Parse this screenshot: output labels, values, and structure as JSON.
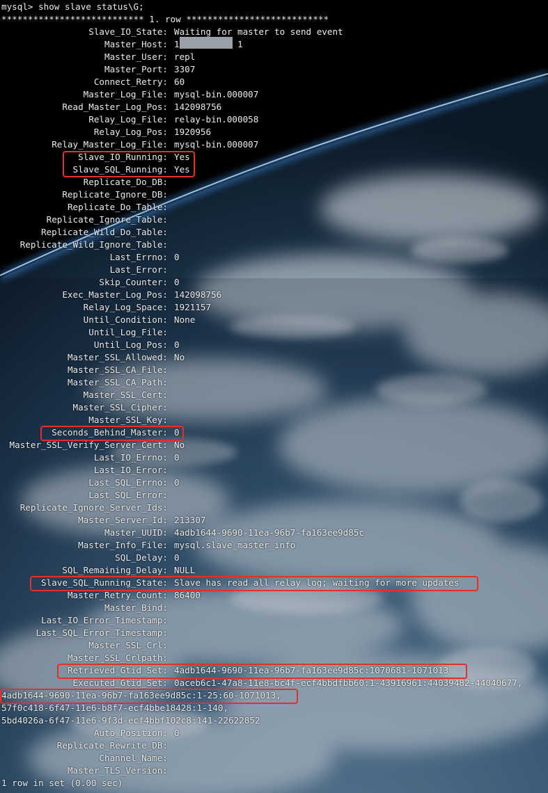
{
  "terminal": {
    "prompt": "mysql> show slave status\\G;",
    "row_header": "*************************** 1. row ***************************",
    "fields": [
      {
        "key": "Slave_IO_State",
        "value": "Waiting for master to send event"
      },
      {
        "key": "Master_Host",
        "value": "1           1"
      },
      {
        "key": "Master_User",
        "value": "repl"
      },
      {
        "key": "Master_Port",
        "value": "3307"
      },
      {
        "key": "Connect_Retry",
        "value": "60"
      },
      {
        "key": "Master_Log_File",
        "value": "mysql-bin.000007"
      },
      {
        "key": "Read_Master_Log_Pos",
        "value": "142098756"
      },
      {
        "key": "Relay_Log_File",
        "value": "relay-bin.000058"
      },
      {
        "key": "Relay_Log_Pos",
        "value": "1920956"
      },
      {
        "key": "Relay_Master_Log_File",
        "value": "mysql-bin.000007"
      },
      {
        "key": "Slave_IO_Running",
        "value": "Yes"
      },
      {
        "key": "Slave_SQL_Running",
        "value": "Yes"
      },
      {
        "key": "Replicate_Do_DB",
        "value": ""
      },
      {
        "key": "Replicate_Ignore_DB",
        "value": ""
      },
      {
        "key": "Replicate_Do_Table",
        "value": ""
      },
      {
        "key": "Replicate_Ignore_Table",
        "value": ""
      },
      {
        "key": "Replicate_Wild_Do_Table",
        "value": ""
      },
      {
        "key": "Replicate_Wild_Ignore_Table",
        "value": ""
      },
      {
        "key": "Last_Errno",
        "value": "0"
      },
      {
        "key": "Last_Error",
        "value": ""
      },
      {
        "key": "Skip_Counter",
        "value": "0"
      },
      {
        "key": "Exec_Master_Log_Pos",
        "value": "142098756"
      },
      {
        "key": "Relay_Log_Space",
        "value": "1921157"
      },
      {
        "key": "Until_Condition",
        "value": "None"
      },
      {
        "key": "Until_Log_File",
        "value": ""
      },
      {
        "key": "Until_Log_Pos",
        "value": "0"
      },
      {
        "key": "Master_SSL_Allowed",
        "value": "No"
      },
      {
        "key": "Master_SSL_CA_File",
        "value": ""
      },
      {
        "key": "Master_SSL_CA_Path",
        "value": ""
      },
      {
        "key": "Master_SSL_Cert",
        "value": ""
      },
      {
        "key": "Master_SSL_Cipher",
        "value": ""
      },
      {
        "key": "Master_SSL_Key",
        "value": ""
      },
      {
        "key": "Seconds_Behind_Master",
        "value": "0"
      },
      {
        "key": "Master_SSL_Verify_Server_Cert",
        "value": "No"
      },
      {
        "key": "Last_IO_Errno",
        "value": "0"
      },
      {
        "key": "Last_IO_Error",
        "value": ""
      },
      {
        "key": "Last_SQL_Errno",
        "value": "0"
      },
      {
        "key": "Last_SQL_Error",
        "value": ""
      },
      {
        "key": "Replicate_Ignore_Server_Ids",
        "value": ""
      },
      {
        "key": "Master_Server_Id",
        "value": "213307"
      },
      {
        "key": "Master_UUID",
        "value": "4adb1644-9690-11ea-96b7-fa163ee9d85c"
      },
      {
        "key": "Master_Info_File",
        "value": "mysql.slave_master_info"
      },
      {
        "key": "SQL_Delay",
        "value": "0"
      },
      {
        "key": "SQL_Remaining_Delay",
        "value": "NULL"
      },
      {
        "key": "Slave_SQL_Running_State",
        "value": "Slave has read all relay log; waiting for more updates"
      },
      {
        "key": "Master_Retry_Count",
        "value": "86400"
      },
      {
        "key": "Master_Bind",
        "value": ""
      },
      {
        "key": "Last_IO_Error_Timestamp",
        "value": ""
      },
      {
        "key": "Last_SQL_Error_Timestamp",
        "value": ""
      },
      {
        "key": "Master_SSL_Crl",
        "value": ""
      },
      {
        "key": "Master_SSL_Crlpath",
        "value": ""
      },
      {
        "key": "Retrieved_Gtid_Set",
        "value": "4adb1644-9690-11ea-96b7-fa163ee9d85c:1070681-1071013"
      },
      {
        "key": "Executed_Gtid_Set",
        "value": "0aceb6c1-47a8-11e8-bc4f-ecf4bbdfbb60:1-43916961:44039482-44040677,"
      }
    ],
    "continuation": [
      "4adb1644-9690-11ea-96b7-fa163ee9d85c:1-25:60-1071013,",
      "57f0c418-6f47-11e6-b8f7-ecf4bbe18428:1-140,",
      "5bd4026a-6f47-11e6-9f3d-ecf4bbf102c8:141-22622852"
    ],
    "tail_fields": [
      {
        "key": "Auto_Position",
        "value": "0"
      },
      {
        "key": "Replicate_Rewrite_DB",
        "value": ""
      },
      {
        "key": "Channel_Name",
        "value": ""
      },
      {
        "key": "Master_TLS_Version",
        "value": ""
      }
    ],
    "footer": "1 row in set (0.00 sec)",
    "highlight_color": "#e2302a"
  }
}
